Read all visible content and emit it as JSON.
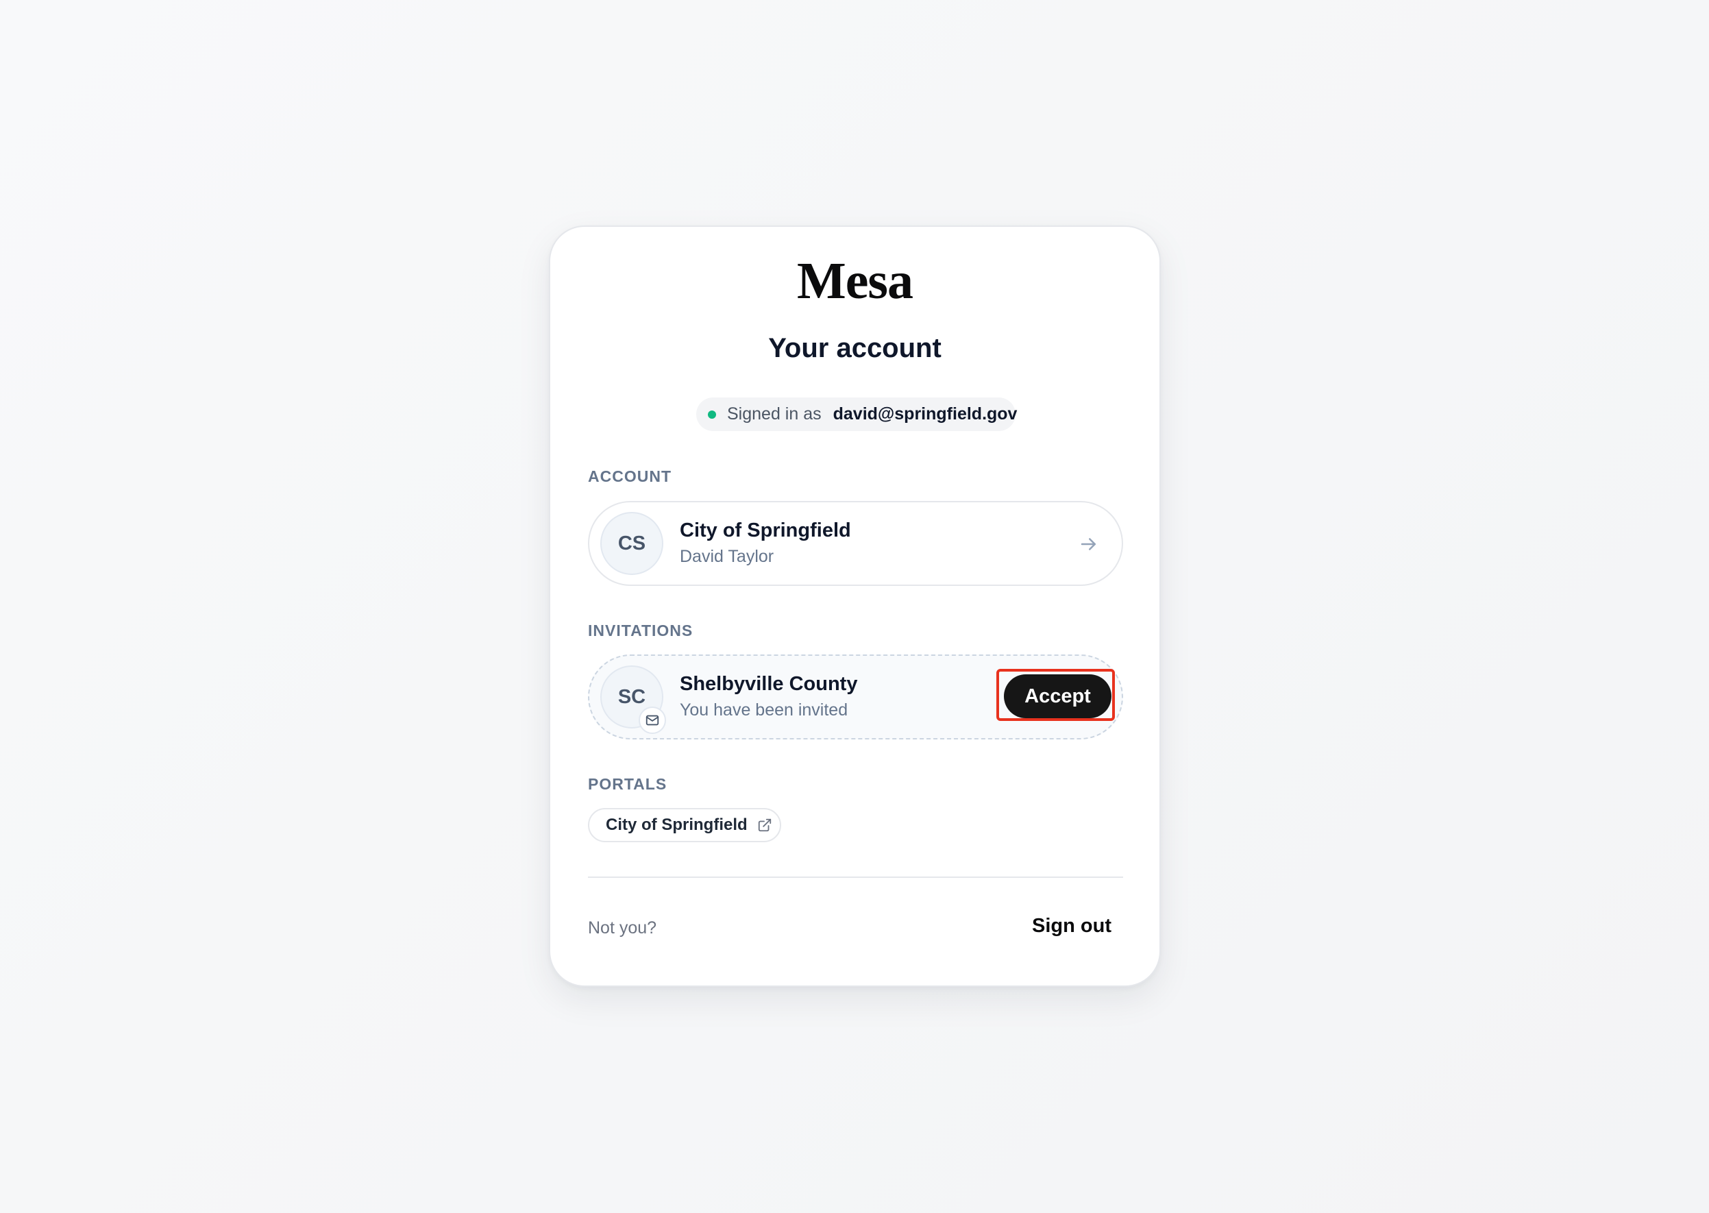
{
  "brand": {
    "logo_text": "Mesa"
  },
  "page": {
    "title": "Your account"
  },
  "session": {
    "signed_in_label": "Signed in as",
    "email": "david@springfield.gov",
    "status_color": "#10b981"
  },
  "account": {
    "section_label": "ACCOUNT",
    "item": {
      "initials": "CS",
      "name": "City of Springfield",
      "user": "David Taylor",
      "icon": "arrow-right-icon"
    }
  },
  "invitations": {
    "section_label": "INVITATIONS",
    "items": [
      {
        "initials": "SC",
        "name": "Shelbyville County",
        "subtitle": "You have been invited",
        "badge_icon": "mail-icon",
        "action_label": "Accept"
      }
    ]
  },
  "portals": {
    "section_label": "PORTALS",
    "items": [
      {
        "label": "City of Springfield",
        "icon": "external-link-icon"
      }
    ]
  },
  "footer": {
    "prompt": "Not you?",
    "sign_out_label": "Sign out"
  },
  "colors": {
    "accent_button": "#161616",
    "highlight_outline": "#e8321e"
  }
}
